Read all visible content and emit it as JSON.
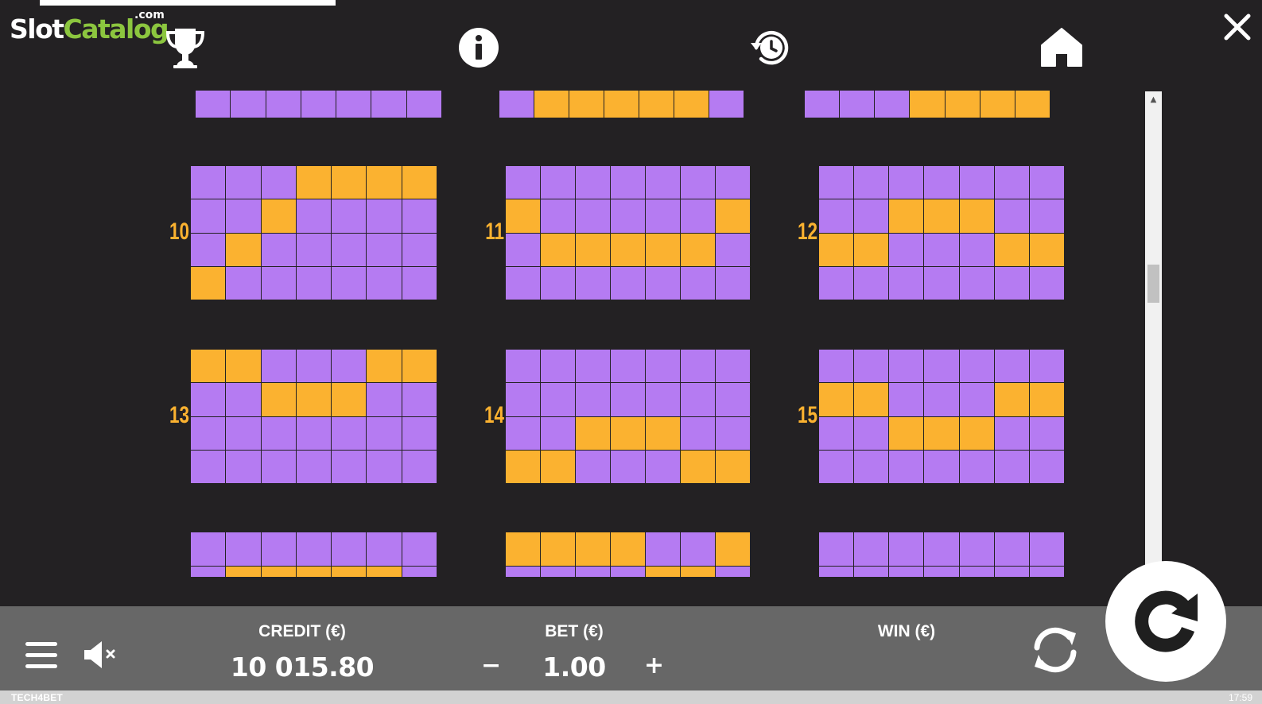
{
  "brand": {
    "logo_slot": "Slot",
    "logo_catalog": "Catalog",
    "logo_com": ".com"
  },
  "top_icons": [
    "trophy-icon",
    "info-icon",
    "history-icon",
    "home-icon",
    "close-icon"
  ],
  "colors": {
    "background": "#232123",
    "cell_off": "#b57bf2",
    "cell_on": "#fbb230",
    "bottom_bar": "#676767",
    "label": "#fbb230"
  },
  "paylines": [
    {
      "label": "",
      "rows": [
        [
          0,
          0,
          0,
          0,
          0,
          0,
          0
        ]
      ],
      "partial": "top"
    },
    {
      "label": "",
      "rows": [
        [
          0,
          1,
          1,
          1,
          1,
          1,
          0
        ]
      ],
      "partial": "top"
    },
    {
      "label": "",
      "rows": [
        [
          0,
          0,
          0,
          1,
          1,
          1,
          1
        ]
      ],
      "partial": "top"
    },
    {
      "label": "10",
      "rows": [
        [
          0,
          0,
          0,
          1,
          1,
          1,
          1
        ],
        [
          0,
          0,
          1,
          0,
          0,
          0,
          0
        ],
        [
          0,
          1,
          0,
          0,
          0,
          0,
          0
        ],
        [
          1,
          0,
          0,
          0,
          0,
          0,
          0
        ]
      ]
    },
    {
      "label": "11",
      "rows": [
        [
          0,
          0,
          0,
          0,
          0,
          0,
          0
        ],
        [
          1,
          0,
          0,
          0,
          0,
          0,
          1
        ],
        [
          0,
          1,
          1,
          1,
          1,
          1,
          0
        ],
        [
          0,
          0,
          0,
          0,
          0,
          0,
          0
        ]
      ]
    },
    {
      "label": "12",
      "rows": [
        [
          0,
          0,
          0,
          0,
          0,
          0,
          0
        ],
        [
          0,
          0,
          1,
          1,
          1,
          0,
          0
        ],
        [
          1,
          1,
          0,
          0,
          0,
          1,
          1
        ],
        [
          0,
          0,
          0,
          0,
          0,
          0,
          0
        ]
      ]
    },
    {
      "label": "13",
      "rows": [
        [
          1,
          1,
          0,
          0,
          0,
          1,
          1
        ],
        [
          0,
          0,
          1,
          1,
          1,
          0,
          0
        ],
        [
          0,
          0,
          0,
          0,
          0,
          0,
          0
        ],
        [
          0,
          0,
          0,
          0,
          0,
          0,
          0
        ]
      ]
    },
    {
      "label": "14",
      "rows": [
        [
          0,
          0,
          0,
          0,
          0,
          0,
          0
        ],
        [
          0,
          0,
          0,
          0,
          0,
          0,
          0
        ],
        [
          0,
          0,
          1,
          1,
          1,
          0,
          0
        ],
        [
          1,
          1,
          0,
          0,
          0,
          1,
          1
        ]
      ]
    },
    {
      "label": "15",
      "rows": [
        [
          0,
          0,
          0,
          0,
          0,
          0,
          0
        ],
        [
          1,
          1,
          0,
          0,
          0,
          1,
          1
        ],
        [
          0,
          0,
          1,
          1,
          1,
          0,
          0
        ],
        [
          0,
          0,
          0,
          0,
          0,
          0,
          0
        ]
      ]
    },
    {
      "label": "",
      "rows": [
        [
          0,
          0,
          0,
          0,
          0,
          0,
          0
        ],
        [
          0,
          1,
          1,
          1,
          1,
          1,
          0
        ]
      ],
      "partial": "bottom"
    },
    {
      "label": "",
      "rows": [
        [
          1,
          1,
          1,
          1,
          0,
          0,
          1
        ],
        [
          0,
          0,
          0,
          0,
          1,
          1,
          0
        ]
      ],
      "partial": "bottom"
    },
    {
      "label": "",
      "rows": [
        [
          0,
          0,
          0,
          0,
          0,
          0,
          0
        ],
        [
          0,
          0,
          0,
          0,
          0,
          0,
          0
        ]
      ],
      "partial": "bottom"
    }
  ],
  "controls": {
    "credit_label": "CREDIT (€)",
    "credit_value": "10 015.80",
    "bet_label": "BET (€)",
    "bet_value": "1.00",
    "bet_minus": "−",
    "bet_plus": "+",
    "win_label": "WIN (€)",
    "win_value": ""
  },
  "footer": {
    "brand": "TECH4BET",
    "time": "17:59"
  }
}
